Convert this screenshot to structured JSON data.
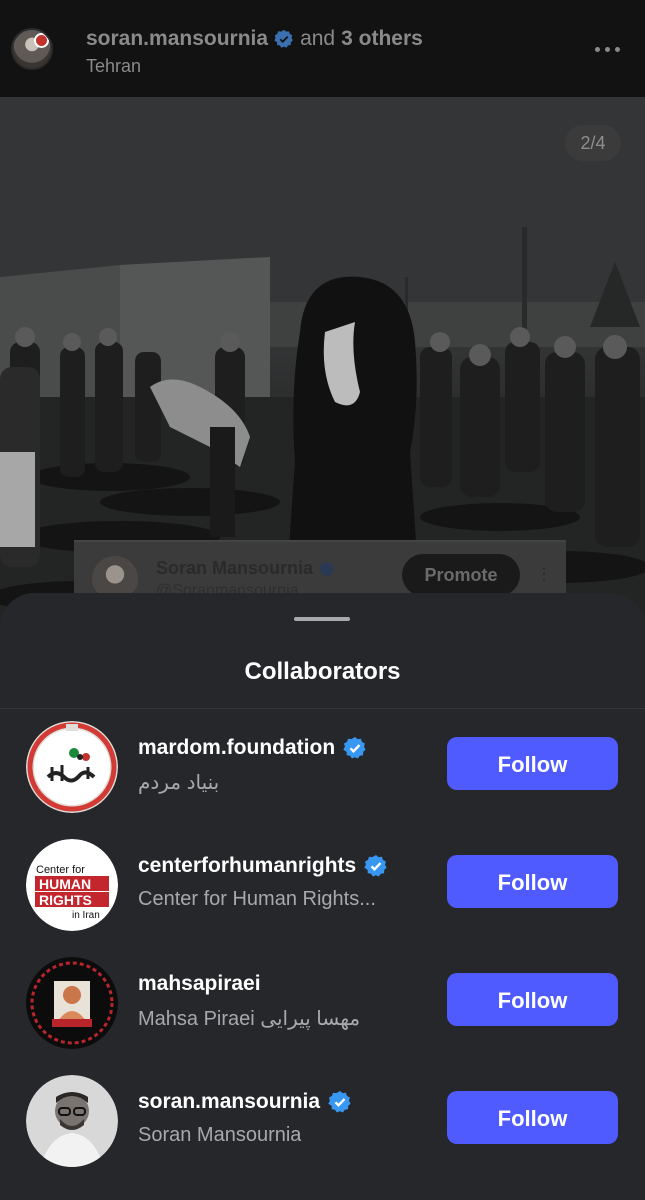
{
  "post": {
    "username": "soran.mansournia",
    "and_text": "and",
    "others_text": "3 others",
    "location": "Tehran",
    "page_counter": "2/4",
    "embed": {
      "name": "Soran Mansournia",
      "handle": "@Soranmansournia",
      "promote_label": "Promote",
      "more_symbol": "⋮"
    }
  },
  "sheet": {
    "title": "Collaborators",
    "follow_label": "Follow",
    "collaborators": [
      {
        "username": "mardom.foundation",
        "full_name": "بنیاد مردم",
        "verified": true,
        "avatar_text": "بنیاد مردم"
      },
      {
        "username": "centerforhumanrights",
        "full_name": "Center for Human Rights...",
        "verified": true,
        "avatar_lines": [
          "Center for",
          "HUMAN",
          "RIGHTS",
          "in Iran"
        ]
      },
      {
        "username": "mahsapiraei",
        "full_name": "Mahsa Piraei مهسا پیرایی",
        "verified": false
      },
      {
        "username": "soran.mansournia",
        "full_name": "Soran Mansournia",
        "verified": true
      }
    ]
  },
  "colors": {
    "follow_button": "#4f5bff",
    "sheet_background": "#26272b",
    "verified_badge": "#3897f0"
  },
  "icons": {
    "verified": "verified-badge-icon",
    "more": "more-options-icon"
  }
}
